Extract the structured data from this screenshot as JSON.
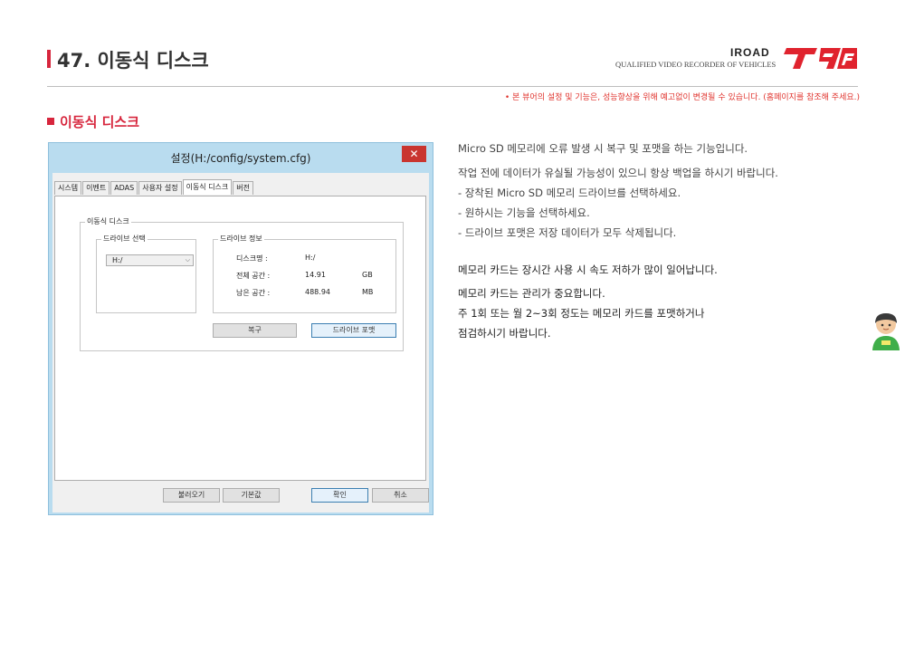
{
  "header": {
    "title": "47. 이동식 디스크",
    "brand_sub": "QUALIFIED VIDEO RECORDER OF VEHICLES",
    "brand_name": "IROAD",
    "logo_text": "T9"
  },
  "notice": "• 본 뷰어의 설정 및 기능은, 성능향상을 위해 예고없이 변경될 수 있습니다. (홈페이지를 참조해 주세요.)",
  "section_title": "이동식 디스크",
  "dialog": {
    "title": "설정(H:/config/system.cfg)",
    "close": "✕",
    "tabs": [
      "시스템",
      "이벤트",
      "ADAS",
      "사용자 설정",
      "이동식 디스크",
      "버전"
    ],
    "active_tab": "이동식 디스크",
    "outer_group": "이동식 디스크",
    "drive_group": "드라이브 선택",
    "drive_value": "H:/",
    "info_group": "드라이브 정보",
    "info": {
      "disk_label": "디스크명 :",
      "disk_value": "H:/",
      "total_label": "전체 공간 :",
      "total_value": "14.91",
      "total_unit": "GB",
      "free_label": "남은 공간 :",
      "free_value": "488.94",
      "free_unit": "MB"
    },
    "recover_button": "복구",
    "format_button": "드라이브 포맷",
    "load_button": "불러오기",
    "default_button": "기본값",
    "ok_button": "확인",
    "cancel_button": "취소"
  },
  "description": [
    "Micro SD 메모리에 오류 발생 시 복구 및 포맷을 하는 기능입니다.",
    "작업 전에 데이터가 유실될 가능성이 있으니 항상 백업을 하시기 바랍니다.",
    "- 장착된 Micro SD 메모리 드라이브를 선택하세요.",
    "- 원하시는 기능을 선택하세요.",
    "- 드라이브 포맷은 저장 데이터가 모두 삭제됩니다."
  ],
  "notes": [
    "메모리 카드는 장시간 사용 시 속도 저하가 많이 일어납니다.",
    "메모리 카드는 관리가 중요합니다.",
    "주 1회 또는 월 2~3회 정도는 메모리 카드를 포맷하거나",
    "점검하시기 바랍니다."
  ],
  "colors": {
    "accent": "#d7263d",
    "notice": "#e0342e",
    "dialog_frame": "#b9dcef",
    "close_button": "#c9352f"
  }
}
